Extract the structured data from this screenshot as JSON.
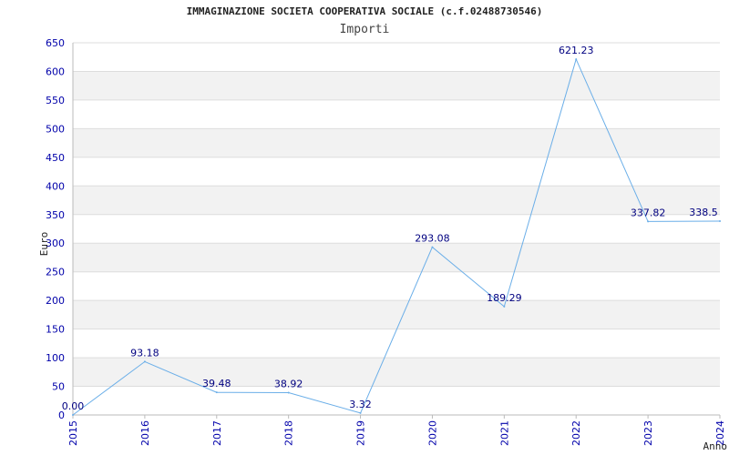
{
  "chart_data": {
    "type": "line",
    "title": "IMMAGINAZIONE SOCIETA COOPERATIVA SOCIALE (c.f.02488730546)",
    "subtitle": "Importi",
    "xlabel": "Anno",
    "ylabel": "Euro",
    "categories": [
      "2015",
      "2016",
      "2017",
      "2018",
      "2019",
      "2020",
      "2021",
      "2022",
      "2023",
      "2024"
    ],
    "series": [
      {
        "values": [
          0.0,
          93.18,
          39.48,
          38.92,
          3.32,
          293.08,
          189.29,
          621.23,
          337.82,
          338.5
        ],
        "labels": [
          "0.00",
          "93.18",
          "39.48",
          "38.92",
          "3.32",
          "293.08",
          "189.29",
          "621.23",
          "337.82",
          "338.5"
        ]
      }
    ],
    "ylim": [
      0,
      650
    ],
    "yticks": [
      0,
      50,
      100,
      150,
      200,
      250,
      300,
      350,
      400,
      450,
      500,
      550,
      600,
      650
    ],
    "grid": true,
    "colors": {
      "line": "#6aaee8",
      "tick": "#0000aa",
      "band": "#f2f2f2",
      "grid": "#dddddd"
    }
  }
}
